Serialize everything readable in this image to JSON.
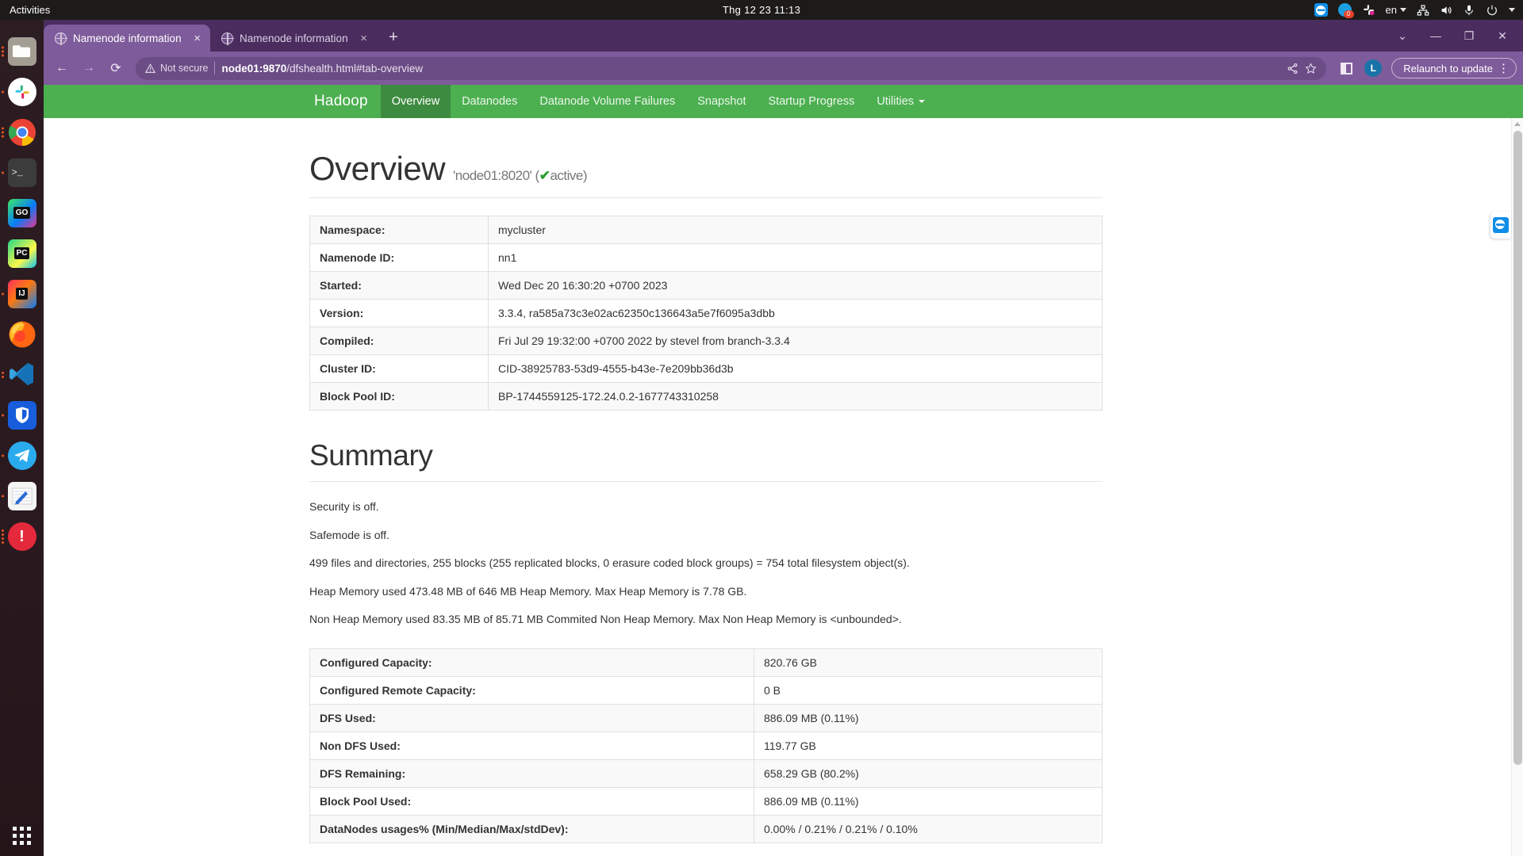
{
  "desktop": {
    "activities_label": "Activities",
    "clock": "Thg 12 23  11:13",
    "tray": {
      "teamviewer_icon": "teamviewer-icon",
      "messages_badge": "0",
      "slack_icon": "slack-icon",
      "language": "en",
      "network_icon": "network-icon",
      "volume_icon": "volume-icon",
      "mic_icon": "microphone-icon",
      "power_icon": "power-icon",
      "menu_caret_icon": "chevron-down-icon"
    },
    "dock": [
      {
        "name": "files",
        "label": "Files",
        "dots": 3
      },
      {
        "name": "slack",
        "label": "Slack",
        "dots": 1
      },
      {
        "name": "chrome",
        "label": "Google Chrome",
        "dots": 3
      },
      {
        "name": "terminal",
        "label": "Terminal",
        "dots": 1
      },
      {
        "name": "goland",
        "label": "GoLand",
        "dots": 0
      },
      {
        "name": "pycharm",
        "label": "PyCharm",
        "dots": 0
      },
      {
        "name": "intellij-idea",
        "label": "IntelliJ IDEA",
        "dots": 1
      },
      {
        "name": "firefox",
        "label": "Firefox",
        "dots": 0
      },
      {
        "name": "vscode",
        "label": "Visual Studio Code",
        "dots": 2
      },
      {
        "name": "bitwarden",
        "label": "Bitwarden",
        "dots": 1
      },
      {
        "name": "telegram",
        "label": "Telegram",
        "dots": 1
      },
      {
        "name": "notes",
        "label": "Notes",
        "dots": 1
      },
      {
        "name": "alert-app",
        "label": "Alert",
        "dots": 4
      }
    ],
    "apps_grid_label": "Show Applications"
  },
  "browser": {
    "tabs": [
      {
        "title": "Namenode information",
        "active": true,
        "close_label": "×"
      },
      {
        "title": "Namenode information",
        "active": false,
        "close_label": "×"
      }
    ],
    "new_tab_label": "+",
    "window_controls": {
      "chevron": "⌄",
      "minimize": "—",
      "maximize": "❐",
      "close": "✕"
    },
    "toolbar": {
      "back_label": "←",
      "forward_label": "→",
      "reload_label": "⟳",
      "security_text": "Not secure",
      "url_host": "node01:9870",
      "url_path": "/dfshealth.html#tab-overview",
      "share_label": "share-icon",
      "bookmark_label": "star-icon",
      "side_panel_label": "side-panel-icon",
      "profile_initial": "L",
      "relaunch_label": "Relaunch to update",
      "menu_label": "⋮"
    }
  },
  "hadoop": {
    "brand": "Hadoop",
    "nav": [
      {
        "label": "Overview",
        "active": true,
        "caret": false
      },
      {
        "label": "Datanodes",
        "active": false,
        "caret": false
      },
      {
        "label": "Datanode Volume Failures",
        "active": false,
        "caret": false
      },
      {
        "label": "Snapshot",
        "active": false,
        "caret": false
      },
      {
        "label": "Startup Progress",
        "active": false,
        "caret": false
      },
      {
        "label": "Utilities",
        "active": false,
        "caret": true
      }
    ],
    "overview": {
      "heading": "Overview",
      "address": "'node01:8020'",
      "state_open": "(",
      "state_check": "✔",
      "state_text": "active",
      "state_close": ")",
      "rows": [
        {
          "key": "Namespace:",
          "value": "mycluster"
        },
        {
          "key": "Namenode ID:",
          "value": "nn1"
        },
        {
          "key": "Started:",
          "value": "Wed Dec 20 16:30:20 +0700 2023"
        },
        {
          "key": "Version:",
          "value": "3.3.4, ra585a73c3e02ac62350c136643a5e7f6095a3dbb"
        },
        {
          "key": "Compiled:",
          "value": "Fri Jul 29 19:32:00 +0700 2022 by stevel from branch-3.3.4"
        },
        {
          "key": "Cluster ID:",
          "value": "CID-38925783-53d9-4555-b43e-7e209bb36d3b"
        },
        {
          "key": "Block Pool ID:",
          "value": "BP-1744559125-172.24.0.2-1677743310258"
        }
      ]
    },
    "summary": {
      "heading": "Summary",
      "lines": [
        "Security is off.",
        "Safemode is off.",
        "499 files and directories, 255 blocks (255 replicated blocks, 0 erasure coded block groups) = 754 total filesystem object(s).",
        "Heap Memory used 473.48 MB of 646 MB Heap Memory. Max Heap Memory is 7.78 GB.",
        "Non Heap Memory used 83.35 MB of 85.71 MB Commited Non Heap Memory. Max Non Heap Memory is <unbounded>."
      ],
      "rows": [
        {
          "key": "Configured Capacity:",
          "value": "820.76 GB"
        },
        {
          "key": "Configured Remote Capacity:",
          "value": "0 B"
        },
        {
          "key": "DFS Used:",
          "value": "886.09 MB (0.11%)"
        },
        {
          "key": "Non DFS Used:",
          "value": "119.77 GB"
        },
        {
          "key": "DFS Remaining:",
          "value": "658.29 GB (80.2%)"
        },
        {
          "key": "Block Pool Used:",
          "value": "886.09 MB (0.11%)"
        },
        {
          "key": "DataNodes usages% (Min/Median/Max/stdDev):",
          "value": "0.00% / 0.21% / 0.21% / 0.10%"
        }
      ]
    }
  },
  "colors": {
    "hadoop_green": "#4caf50",
    "hadoop_green_active": "#3d8b40",
    "chrome_purple": "#7e5b9a",
    "chrome_purple_dark": "#4a2d5e",
    "ubuntu_orange": "#e95420",
    "active_green": "#2e9e2e"
  }
}
